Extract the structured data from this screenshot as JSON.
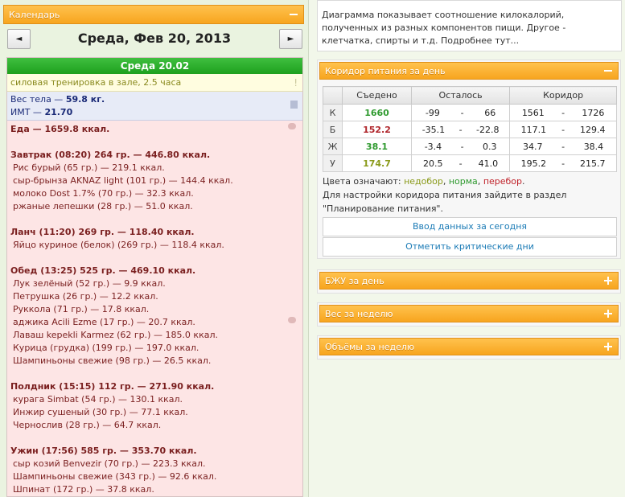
{
  "calendar": {
    "title": "Календарь",
    "date_label": "Среда, Фев 20, 2013",
    "prev_label": "◄",
    "next_label": "►"
  },
  "day": {
    "header": "Среда 20.02",
    "training": "силовая тренировка в зале, 2.5 часа",
    "weight_prefix": "Вес тела — ",
    "weight_value": "59.8 кг.",
    "bmi_prefix": "ИМТ — ",
    "bmi_value": "21.70",
    "food_total": "Еда — 1659.8 ккал."
  },
  "meals": [
    {
      "title": "Завтрак (08:20) 264 гр. — 446.80 ккал.",
      "items": [
        "Рис бурый (65 гр.) — 219.1 ккал.",
        "сыр-брынза AKNAZ light (101 гр.) — 144.4 ккал.",
        "молоко Dost 1.7% (70 гр.) — 32.3 ккал.",
        "ржаные лепешки (28 гр.) — 51.0 ккал."
      ]
    },
    {
      "title": "Ланч (11:20) 269 гр. — 118.40 ккал.",
      "items": [
        "Яйцо куриное (белок) (269 гр.) — 118.4 ккал."
      ]
    },
    {
      "title": "Обед (13:25) 525 гр. — 469.10 ккал.",
      "items": [
        "Лук зелёный (52 гр.) — 9.9 ккал.",
        "Петрушка (26 гр.) — 12.2 ккал.",
        "Руккола (71 гр.) — 17.8 ккал.",
        "аджика Acili Ezme (17 гр.) — 20.7 ккал.",
        "Лаваш kepekli Karmez (62 гр.) — 185.0 ккал.",
        "Курица (грудка) (199 гр.) — 197.0 ккал.",
        "Шампиньоны свежие (98 гр.) — 26.5 ккал."
      ]
    },
    {
      "title": "Полдник (15:15) 112 гр. — 271.90 ккал.",
      "items": [
        "курага Simbat (54 гр.) — 130.1 ккал.",
        "Инжир сушеный (30 гр.) — 77.1 ккал.",
        "Чернослив (28 гр.) — 64.7 ккал."
      ]
    },
    {
      "title": "Ужин (17:56) 585 гр. — 353.70 ккал.",
      "items": [
        "сыр козий Benvezir (70 гр.) — 223.3 ккал.",
        "Шампиньоны свежие (343 гр.) — 92.6 ккал.",
        "Шпинат (172 гр.) — 37.8 ккал."
      ]
    }
  ],
  "description": "Диаграмма показывает соотношение килокалорий, полученных из разных компонентов пищи. Другое - клетчатка, спирты и т.д. Подробнее тут...",
  "corridor": {
    "title": "Коридор питания за день",
    "headers": {
      "eaten": "Съедено",
      "left": "Осталось",
      "corridor": "Коридор"
    },
    "rows": [
      {
        "key": "К",
        "eaten": "1660",
        "color": "green",
        "left_a": "-99",
        "left_b": "66",
        "cor_a": "1561",
        "cor_b": "1726"
      },
      {
        "key": "Б",
        "eaten": "152.2",
        "color": "red",
        "left_a": "-35.1",
        "left_b": "-22.8",
        "cor_a": "117.1",
        "cor_b": "129.4"
      },
      {
        "key": "Ж",
        "eaten": "38.1",
        "color": "green",
        "left_a": "-3.4",
        "left_b": "0.3",
        "cor_a": "34.7",
        "cor_b": "38.4"
      },
      {
        "key": "У",
        "eaten": "174.7",
        "color": "olive",
        "left_a": "20.5",
        "left_b": "41.0",
        "cor_a": "195.2",
        "cor_b": "215.7"
      }
    ],
    "dash": "-",
    "legend_prefix": "Цвета означают: ",
    "legend_under": "недобор",
    "legend_comma1": ", ",
    "legend_norm": "норма",
    "legend_comma2": ", ",
    "legend_over": "перебор",
    "legend_dot": ".",
    "settings_note": "Для настройки коридора питания зайдите в раздел \"Планирование питания\".",
    "btn_today": "Ввод данных за сегодня",
    "btn_critical": "Отметить критические дни"
  },
  "panels": {
    "bju": "БЖУ за день",
    "weight": "Вес за неделю",
    "volumes": "Объёмы за неделю"
  }
}
